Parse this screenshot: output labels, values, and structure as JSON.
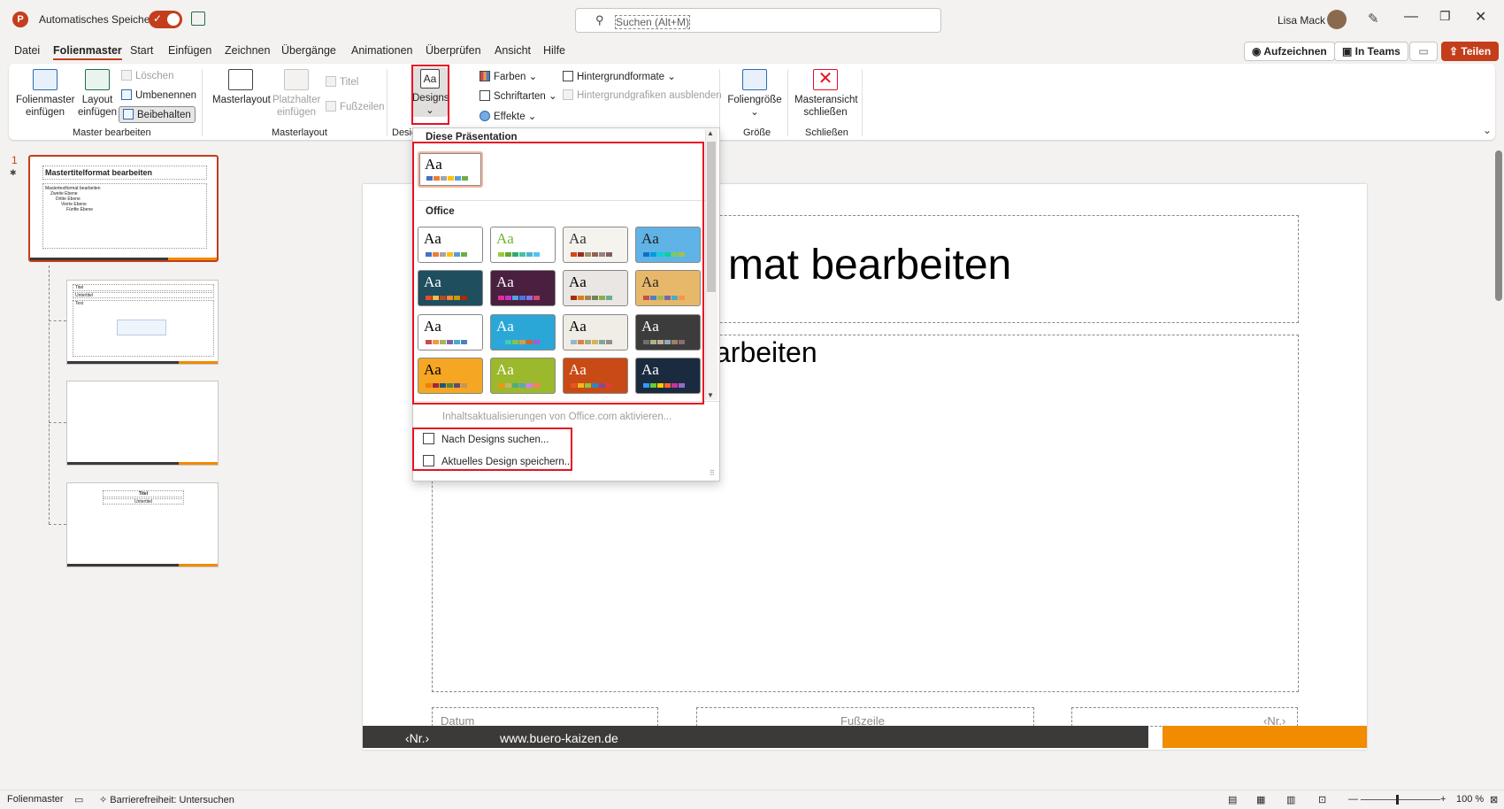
{
  "titlebar": {
    "autosave_label": "Automatisches Speichern",
    "search_placeholder": "Suchen (Alt+M)",
    "user_name": "Lisa Mack",
    "app_letter": "P"
  },
  "menu": {
    "tabs": [
      "Datei",
      "Folienmaster",
      "Start",
      "Einfügen",
      "Zeichnen",
      "Übergänge",
      "Animationen",
      "Überprüfen",
      "Ansicht",
      "Hilfe"
    ],
    "active_tab": "Folienmaster",
    "record": "Aufzeichnen",
    "teams": "In Teams",
    "share": "Teilen"
  },
  "ribbon": {
    "insert_master": [
      "Folienmaster",
      "einfügen"
    ],
    "insert_layout": [
      "Layout",
      "einfügen"
    ],
    "delete": "Löschen",
    "rename": "Umbenennen",
    "preserve": "Beibehalten",
    "group_master": "Master bearbeiten",
    "master_layout": "Masterlayout",
    "insert_placeholder": [
      "Platzhalter",
      "einfügen"
    ],
    "title_cb": "Titel",
    "footers_cb": "Fußzeilen",
    "group_layout": "Masterlayout",
    "designs": "Designs",
    "group_design": "Desig",
    "colors": "Farben",
    "fonts": "Schriftarten",
    "effects": "Effekte",
    "bg_formats": "Hintergrundformate",
    "hide_bg": "Hintergrundgrafiken ausblenden",
    "slide_size": "Foliengröße",
    "group_size": "Größe",
    "close_master": [
      "Masteransicht",
      "schließen"
    ],
    "group_close": "Schließen"
  },
  "gallery": {
    "section_this": "Diese Präsentation",
    "section_office": "Office",
    "aa": "Aa",
    "enable_updates": "Inhaltsaktualisierungen von Office.com aktivieren...",
    "browse": "Nach Designs suchen...",
    "save_current": "Aktuelles Design speichern...",
    "themes": [
      {
        "bg": "#ffffff",
        "fg": "#000000",
        "sw": [
          "#4472c4",
          "#ed7d31",
          "#a5a5a5",
          "#ffc000",
          "#5b9bd5",
          "#70ad47"
        ]
      },
      {
        "bg": "#ffffff",
        "fg": "#000000",
        "sw": [
          "#4472c4",
          "#ed7d31",
          "#a5a5a5",
          "#ffc000",
          "#5b9bd5",
          "#70ad47"
        ]
      },
      {
        "bg": "#ffffff",
        "fg": "#6fb52c",
        "sw": [
          "#99cb38",
          "#63a537",
          "#37a76f",
          "#44c1a3",
          "#4eb3cf",
          "#51c3f9"
        ]
      },
      {
        "bg": "#f5f3ee",
        "fg": "#333333",
        "sw": [
          "#d34817",
          "#9b2d1f",
          "#a28e6a",
          "#956251",
          "#918485",
          "#855d5d"
        ]
      },
      {
        "bg": "#5fb3e6",
        "fg": "#1f1f1f",
        "sw": [
          "#0f6fc6",
          "#009dd9",
          "#0bd0d9",
          "#10cf9b",
          "#7cca62",
          "#a5c249"
        ]
      },
      {
        "bg": "#1f4e5f",
        "fg": "#ffffff",
        "sw": [
          "#e84c22",
          "#ffbd47",
          "#b64926",
          "#ff8427",
          "#cc9900",
          "#b22600"
        ]
      },
      {
        "bg": "#4a1f3f",
        "fg": "#ffffff",
        "sw": [
          "#e32d91",
          "#c830cc",
          "#4ea6dc",
          "#4775e7",
          "#8971e1",
          "#d54773"
        ]
      },
      {
        "bg": "#e9e6e4",
        "fg": "#000000",
        "sw": [
          "#a53010",
          "#de7e18",
          "#9f8351",
          "#728653",
          "#92aa4c",
          "#6aac91"
        ]
      },
      {
        "bg": "#e8b86a",
        "fg": "#2b2b2b",
        "sw": [
          "#c0504d",
          "#4f81bd",
          "#9bbb59",
          "#8064a2",
          "#4bacc6",
          "#f79646"
        ]
      },
      {
        "bg": "#ffffff",
        "fg": "#000000",
        "sw": [
          "#c0504d",
          "#f79646",
          "#9bbb59",
          "#8064a2",
          "#4bacc6",
          "#4f81bd"
        ]
      },
      {
        "bg": "#2aa7d6",
        "fg": "#ffffff",
        "sw": [
          "#2fa3ee",
          "#4bcaad",
          "#86c157",
          "#d99c3f",
          "#ce6633",
          "#a35dd1"
        ]
      },
      {
        "bg": "#f0ede6",
        "fg": "#000000",
        "sw": [
          "#94b6d2",
          "#dd8047",
          "#a5ab81",
          "#d8b25c",
          "#7ba79d",
          "#968c8c"
        ]
      },
      {
        "bg": "#3c3c3c",
        "fg": "#ffffff",
        "sw": [
          "#6f6f74",
          "#a7b789",
          "#beae98",
          "#92a9b9",
          "#9c8265",
          "#8d6974"
        ]
      },
      {
        "bg": "#f5a623",
        "fg": "#000000",
        "sw": [
          "#f07f09",
          "#9f2936",
          "#1b587c",
          "#4e8542",
          "#604878",
          "#c19859"
        ]
      },
      {
        "bg": "#9cb82c",
        "fg": "#ffffff",
        "sw": [
          "#f09415",
          "#c1b56b",
          "#4baf73",
          "#5aa6c0",
          "#d17df9",
          "#fa7e5c"
        ]
      },
      {
        "bg": "#c84b16",
        "fg": "#ffffff",
        "sw": [
          "#e8541e",
          "#f3ba1b",
          "#8dc641",
          "#2c87c7",
          "#7f4b9a",
          "#e23d3d"
        ]
      },
      {
        "bg": "#1b2b3f",
        "fg": "#ffffff",
        "sw": [
          "#3399ff",
          "#66cc33",
          "#ffcc00",
          "#ff6633",
          "#cc3399",
          "#9966cc"
        ]
      }
    ]
  },
  "thumbnails": {
    "t1_title": "Mastertitelformat bearbeiten",
    "t1_body": [
      "Mastertextformat bearbeiten",
      "Zweite Ebene",
      "Dritte Ebene",
      "Vierte Ebene",
      "Fünfte Ebene"
    ],
    "t2_title": "Titel",
    "t2_sub": "Untertitel",
    "t2_text": "Text",
    "t4_title": "Titel",
    "t4_sub": "Untertitel",
    "slide_number": "1"
  },
  "slide": {
    "title_partial": "mat bearbeiten",
    "sub_partial": "arbeiten",
    "date_ph": "Datum",
    "footer_ph": "Fußzeile",
    "nr_ph": "‹Nr.›",
    "footer_nr": "‹Nr.›",
    "footer_url": "www.buero-kaizen.de"
  },
  "status": {
    "view": "Folienmaster",
    "accessibility": "Barrierefreiheit: Untersuchen",
    "zoom": "100 %"
  },
  "colors": {
    "accent": "#c43e1c",
    "highlight_box": "#e81123",
    "footer_dark": "#3b3a39",
    "footer_orange": "#f18b00"
  }
}
